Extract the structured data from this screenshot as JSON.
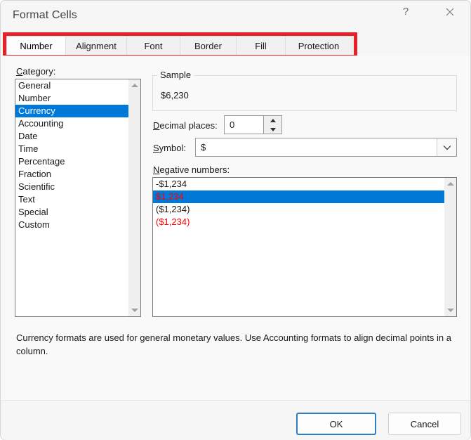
{
  "window": {
    "title": "Format Cells",
    "help_icon": "question-mark-icon",
    "close_icon": "close-icon"
  },
  "tabs": [
    {
      "label": "Number",
      "active": true
    },
    {
      "label": "Alignment",
      "active": false
    },
    {
      "label": "Font",
      "active": false
    },
    {
      "label": "Border",
      "active": false
    },
    {
      "label": "Fill",
      "active": false
    },
    {
      "label": "Protection",
      "active": false
    }
  ],
  "annotation": {
    "shape": "rectangle",
    "color": "#e8202a",
    "target": "tab-strip"
  },
  "category": {
    "label": "Category:",
    "accelerator": "C",
    "items": [
      "General",
      "Number",
      "Currency",
      "Accounting",
      "Date",
      "Time",
      "Percentage",
      "Fraction",
      "Scientific",
      "Text",
      "Special",
      "Custom"
    ],
    "selected": "Currency",
    "selected_index": 2,
    "selection_color": "#0078d7"
  },
  "sample": {
    "legend": "Sample",
    "value": "$6,230"
  },
  "decimal_places": {
    "label": "Decimal places:",
    "accelerator": "D",
    "value": "0",
    "up_icon": "spinner-up-icon",
    "down_icon": "spinner-down-icon"
  },
  "symbol": {
    "label": "Symbol:",
    "accelerator": "S",
    "value": "$",
    "dropdown_icon": "chevron-down-icon"
  },
  "negative_numbers": {
    "label": "Negative numbers:",
    "accelerator": "N",
    "selected_index": 1,
    "selection_color": "#0078d7",
    "items": [
      {
        "text": "-$1,234",
        "color": "#1a1a1a",
        "selected": false
      },
      {
        "text": "$1,234",
        "color": "#ff0000",
        "selected": true
      },
      {
        "text": "($1,234)",
        "color": "#1a1a1a",
        "selected": false
      },
      {
        "text": "($1,234)",
        "color": "#ff0000",
        "selected": false
      }
    ]
  },
  "description": "Currency formats are used for general monetary values.  Use Accounting formats to align decimal points in a column.",
  "footer": {
    "ok_label": "OK",
    "cancel_label": "Cancel",
    "default_button": "OK",
    "focus_color": "#2e7cc4"
  },
  "scrollbars": {
    "up_icon": "scroll-up-arrow-icon",
    "down_icon": "scroll-down-arrow-icon"
  }
}
